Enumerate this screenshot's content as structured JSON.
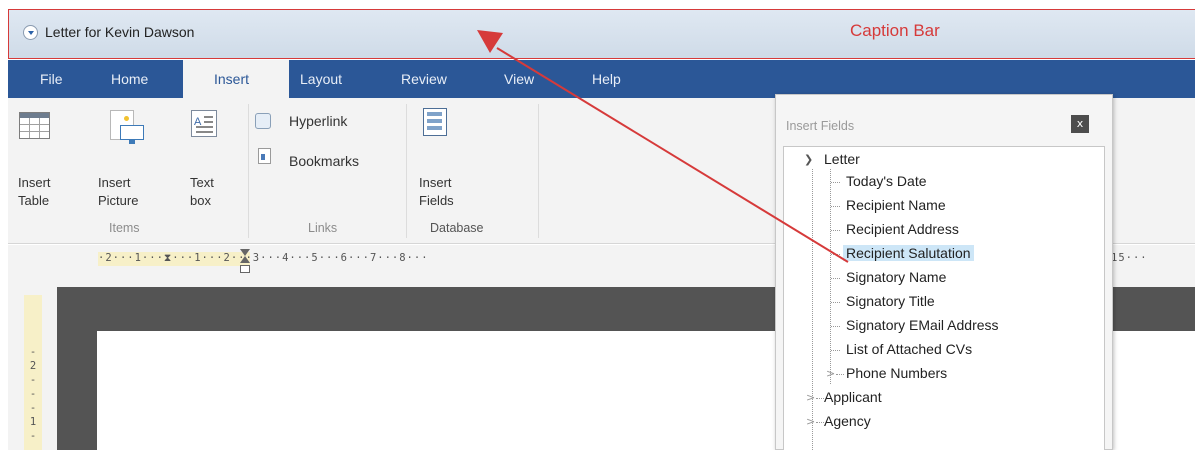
{
  "window": {
    "title": "Letter for Kevin Dawson",
    "caption_annotation": "Caption Bar"
  },
  "menu": {
    "tabs": [
      "File",
      "Home",
      "Insert",
      "Layout",
      "Review",
      "View",
      "Help"
    ],
    "active_tab": "Insert"
  },
  "ribbon": {
    "insert_table": [
      "Insert",
      "Table"
    ],
    "insert_picture": [
      "Insert",
      "Picture"
    ],
    "text_box": [
      "Text",
      "box"
    ],
    "hyperlink": "Hyperlink",
    "bookmarks": "Bookmarks",
    "insert_fields": [
      "Insert",
      "Fields"
    ],
    "groups": {
      "items": "Items",
      "links": "Links",
      "database": "Database"
    }
  },
  "ruler": {
    "horizontal": "·2···1···⧗···1···2···3···4···5···6···7···8···",
    "right": "15···",
    "vertical": [
      "2",
      "1"
    ]
  },
  "insert_fields_panel": {
    "title": "Insert Fields",
    "close": "x",
    "tree": {
      "letter": "Letter",
      "letter_children": [
        "Today's Date",
        "Recipient Name",
        "Recipient Address",
        "Recipient Salutation",
        "Signatory Name",
        "Signatory Title",
        "Signatory EMail Address",
        "List of Attached CVs",
        "Phone Numbers"
      ],
      "selected": "Recipient Salutation",
      "applicant": "Applicant",
      "agency": "Agency"
    }
  },
  "colors": {
    "menubar": "#2b5797",
    "annotation": "#d63a3a",
    "selection": "#cde6f7"
  }
}
